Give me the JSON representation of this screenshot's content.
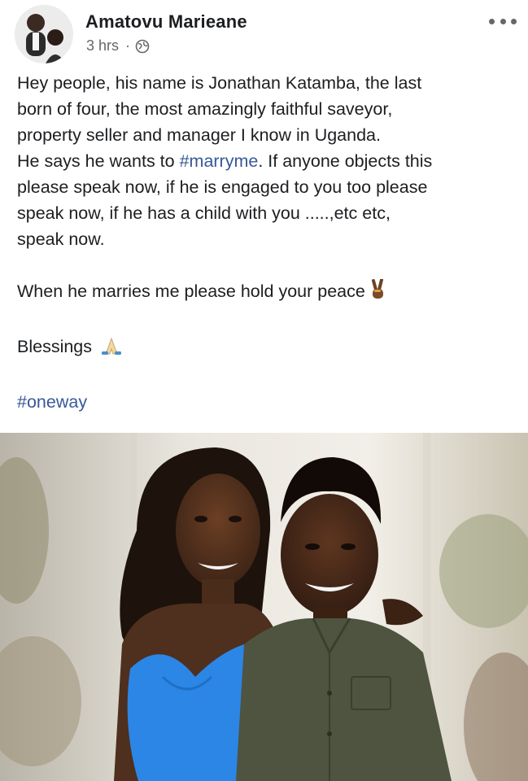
{
  "post": {
    "author_name": "Amatovu Marieane",
    "timestamp": "3 hrs",
    "separator": "·",
    "privacy_icon": "globe-icon",
    "more_icon": "more-options-icon",
    "body": {
      "line1": "Hey people, his name is Jonathan Katamba, the last",
      "line2": "born of four, the most amazingly faithful saveyor,",
      "line3": "property seller and manager I know in Uganda.",
      "line4_pre": "He says he wants to ",
      "line4_tag": "#marryme",
      "line4_post": ". If anyone objects this",
      "line5": "please speak now, if he is engaged to you too please",
      "line6": "speak now, if he has a child with you .....,etc etc,",
      "line7": "speak now.",
      "peace_line": "When he marries me please hold your peace",
      "peace_emoji": "victory-hand-emoji",
      "blessings": "Blessings",
      "blessings_emoji": "praying-hands-emoji",
      "closing_tag": "#oneway"
    },
    "colors": {
      "text": "#1c1e21",
      "meta": "#65676b",
      "link": "#385898"
    }
  }
}
